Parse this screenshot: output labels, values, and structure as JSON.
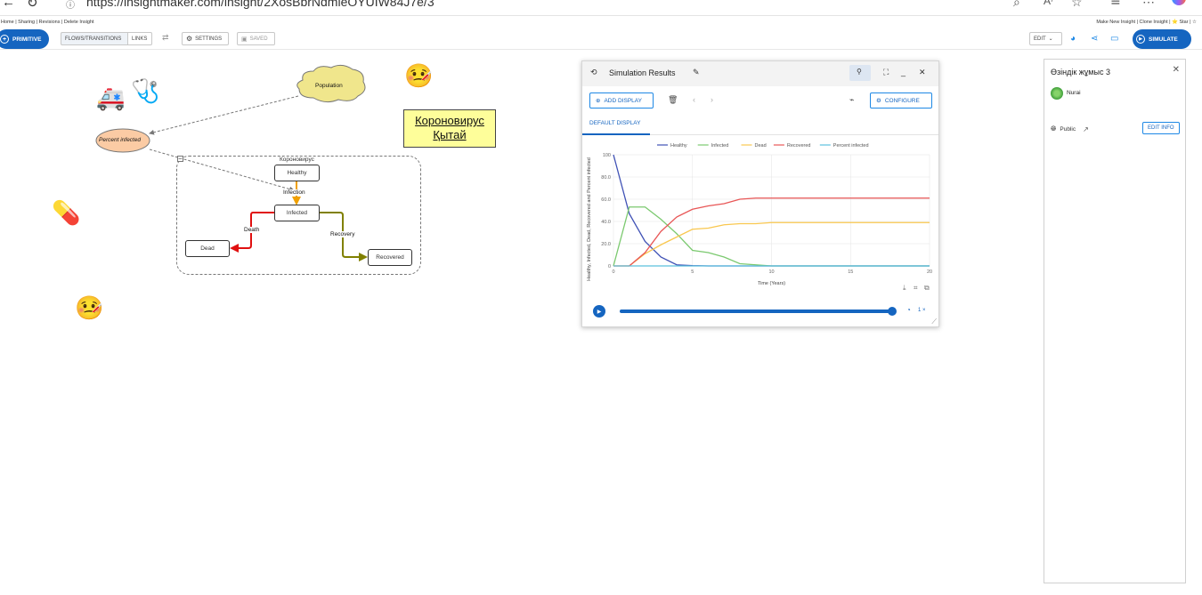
{
  "browser": {
    "url": "https://insightmaker.com/insight/2XosBbrNdmleOYUIW84J7e/3",
    "icons": [
      "back-arrow-icon",
      "reload-icon",
      "info-icon",
      "search-icon",
      "read-aloud-icon",
      "favorite-star-icon",
      "favorites-list-icon",
      "more-icon",
      "copilot-icon"
    ]
  },
  "topnav": {
    "left": "Home | Sharing | Revisions | Delete Insight",
    "right": "Make New Insight | Clone Insight | ⭐ Star | ☆"
  },
  "toolbar": {
    "primitive_label": "PRIMITIVE",
    "flows_label": "FLOWS/TRANSITIONS",
    "links_label": "LINKS",
    "swap_icon": "⇄",
    "settings_label": "SETTINGS",
    "saved_label": "SAVED",
    "edit_label": "EDIT",
    "simulate_label": "SIMULATE"
  },
  "canvas": {
    "population_label": "Population",
    "percent_infected_label": "Percent infected",
    "folder_title": "Короновирус",
    "folder_collapse": "–",
    "stocks": {
      "healthy": "Healthy",
      "infected": "Infected",
      "dead": "Dead",
      "recovered": "Recovered"
    },
    "flows": {
      "infection": "Infection",
      "death": "Death",
      "recovery": "Recovery"
    },
    "note_line1": "Короновирус",
    "note_line2": "Қытай",
    "emojis": {
      "ambulance": "🚑",
      "stethoscope": "🩺",
      "sick_face_top": "🤒",
      "pill": "💊",
      "sick_face_bottom": "🤒"
    }
  },
  "sim": {
    "title": "Simulation Results",
    "add_display_label": "ADD DISPLAY",
    "configure_label": "CONFIGURE",
    "tab_label": "DEFAULT DISPLAY",
    "speed_label": "1 ×",
    "chart_icons": [
      "download-icon",
      "crop-icon",
      "expand-icon"
    ]
  },
  "chart_data": {
    "type": "line",
    "xlabel": "Time (Years)",
    "ylabel": "Healthy, Infected, Dead, Recovered and Percent infected",
    "xlim": [
      0,
      20
    ],
    "ylim": [
      0,
      100
    ],
    "xticks": [
      "0",
      "5",
      "10",
      "15",
      "20"
    ],
    "yticks": [
      "0",
      "20.0",
      "40.0",
      "60.0",
      "80.0",
      "100"
    ],
    "grid": true,
    "legend_position": "top",
    "series": [
      {
        "name": "Healthy",
        "color": "#3f51b5",
        "x": [
          0,
          1,
          2,
          3,
          4,
          5,
          6,
          20
        ],
        "values": [
          100,
          47,
          22,
          8,
          1,
          0.3,
          0,
          0
        ]
      },
      {
        "name": "Infected",
        "color": "#7bc96f",
        "x": [
          0,
          1,
          2,
          3,
          4,
          5,
          6,
          7,
          8,
          9,
          10,
          20
        ],
        "values": [
          0,
          53,
          53,
          42,
          29,
          14,
          12,
          8,
          2,
          1,
          0,
          0
        ]
      },
      {
        "name": "Dead",
        "color": "#f9c74f",
        "x": [
          0,
          1,
          2,
          3,
          4,
          5,
          6,
          7,
          8,
          9,
          10,
          20
        ],
        "values": [
          0,
          0,
          11,
          19,
          26,
          33,
          34,
          37,
          38,
          38,
          39,
          39
        ]
      },
      {
        "name": "Recovered",
        "color": "#e85656",
        "x": [
          0,
          1,
          2,
          3,
          4,
          5,
          6,
          7,
          8,
          9,
          10,
          20
        ],
        "values": [
          0,
          0,
          12,
          31,
          44,
          51,
          54,
          56,
          60,
          61,
          61,
          61
        ]
      },
      {
        "name": "Percent infected",
        "color": "#5bc0de",
        "x": [
          0,
          20
        ],
        "values": [
          0,
          0
        ]
      }
    ]
  },
  "info": {
    "title": "Өзіндік жұмыс 3",
    "author": "Nurai",
    "visibility": "Public",
    "edit_info_label": "EDIT INFO"
  }
}
